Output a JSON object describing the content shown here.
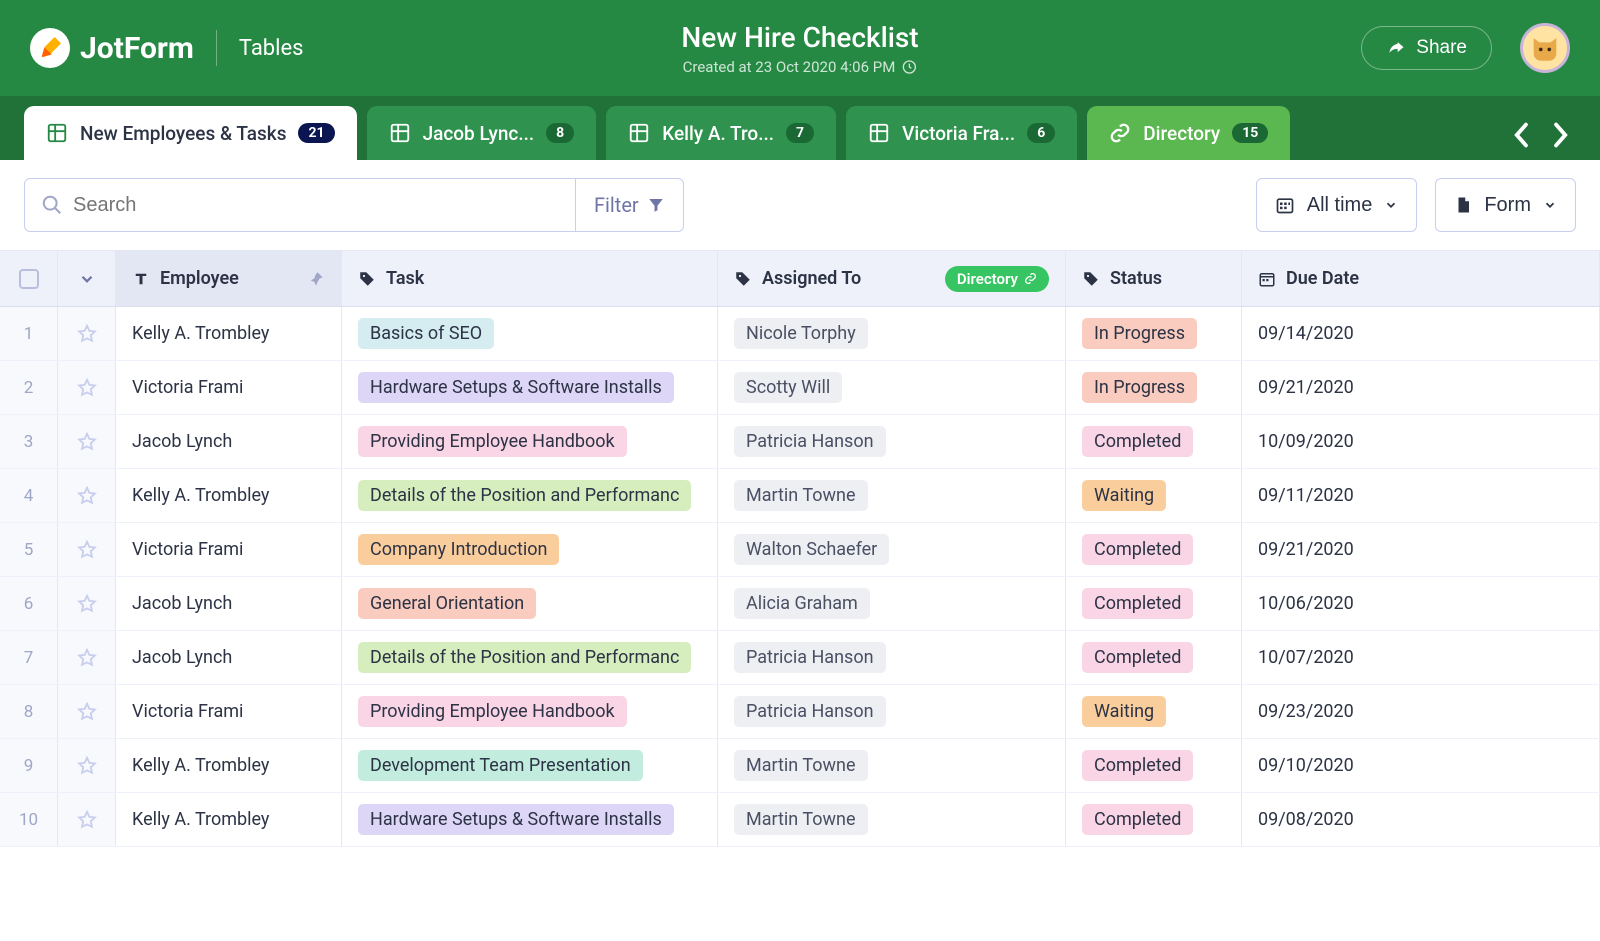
{
  "header": {
    "brand": "JotForm",
    "subapp": "Tables",
    "title": "New Hire Checklist",
    "subtitle": "Created at 23 Oct 2020 4:06 PM",
    "share_label": "Share"
  },
  "tabs": [
    {
      "label": "New Employees & Tasks",
      "count": "21",
      "active": true,
      "type": "grid"
    },
    {
      "label": "Jacob Lync...",
      "count": "8",
      "active": false,
      "type": "grid"
    },
    {
      "label": "Kelly A. Tro...",
      "count": "7",
      "active": false,
      "type": "grid"
    },
    {
      "label": "Victoria Fra...",
      "count": "6",
      "active": false,
      "type": "grid"
    },
    {
      "label": "Directory",
      "count": "15",
      "active": false,
      "type": "link"
    }
  ],
  "toolbar": {
    "search_placeholder": "Search",
    "filter_label": "Filter",
    "range_label": "All time",
    "form_label": "Form"
  },
  "columns": {
    "employee": "Employee",
    "task": "Task",
    "assigned": "Assigned To",
    "assigned_badge": "Directory",
    "status": "Status",
    "due": "Due Date"
  },
  "rows": [
    {
      "idx": "1",
      "employee": "Kelly A. Trombley",
      "task": "Basics of SEO",
      "task_color": "blue",
      "assigned": "Nicole Torphy",
      "status": "In Progress",
      "status_class": "progress",
      "due": "09/14/2020"
    },
    {
      "idx": "2",
      "employee": "Victoria Frami",
      "task": "Hardware Setups & Software Installs",
      "task_color": "purple",
      "assigned": "Scotty Will",
      "status": "In Progress",
      "status_class": "progress",
      "due": "09/21/2020"
    },
    {
      "idx": "3",
      "employee": "Jacob Lynch",
      "task": "Providing Employee Handbook",
      "task_color": "pink",
      "assigned": "Patricia Hanson",
      "status": "Completed",
      "status_class": "completed",
      "due": "10/09/2020"
    },
    {
      "idx": "4",
      "employee": "Kelly A. Trombley",
      "task": "Details of the Position and Performanc",
      "task_color": "green",
      "assigned": "Martin Towne",
      "status": "Waiting",
      "status_class": "waiting",
      "due": "09/11/2020"
    },
    {
      "idx": "5",
      "employee": "Victoria Frami",
      "task": "Company Introduction",
      "task_color": "orange",
      "assigned": "Walton Schaefer",
      "status": "Completed",
      "status_class": "completed",
      "due": "09/21/2020"
    },
    {
      "idx": "6",
      "employee": "Jacob Lynch",
      "task": "General Orientation",
      "task_color": "red",
      "assigned": "Alicia Graham",
      "status": "Completed",
      "status_class": "completed",
      "due": "10/06/2020"
    },
    {
      "idx": "7",
      "employee": "Jacob Lynch",
      "task": "Details of the Position and Performanc",
      "task_color": "green",
      "assigned": "Patricia Hanson",
      "status": "Completed",
      "status_class": "completed",
      "due": "10/07/2020"
    },
    {
      "idx": "8",
      "employee": "Victoria Frami",
      "task": "Providing Employee Handbook",
      "task_color": "pink",
      "assigned": "Patricia Hanson",
      "status": "Waiting",
      "status_class": "waiting",
      "due": "09/23/2020"
    },
    {
      "idx": "9",
      "employee": "Kelly A. Trombley",
      "task": "Development Team Presentation",
      "task_color": "mint",
      "assigned": "Martin Towne",
      "status": "Completed",
      "status_class": "completed",
      "due": "09/10/2020"
    },
    {
      "idx": "10",
      "employee": "Kelly A. Trombley",
      "task": "Hardware Setups & Software Installs",
      "task_color": "purple",
      "assigned": "Martin Towne",
      "status": "Completed",
      "status_class": "completed",
      "due": "09/08/2020"
    }
  ]
}
